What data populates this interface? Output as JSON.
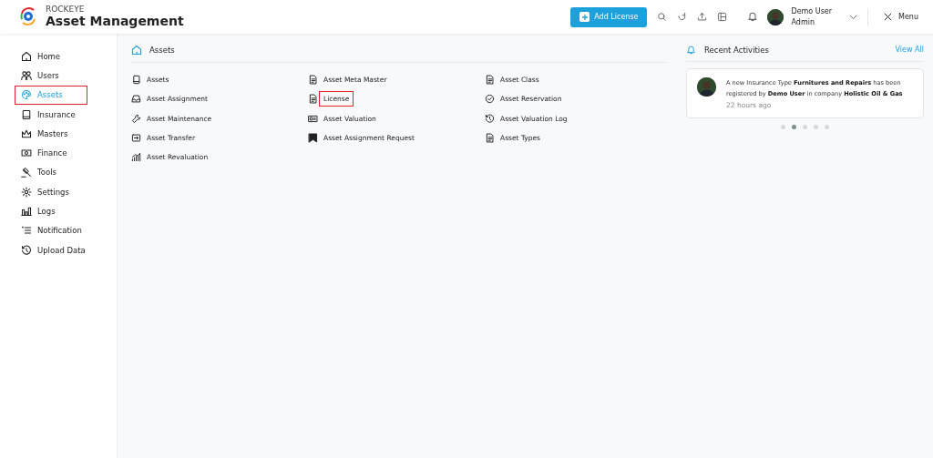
{
  "header": {
    "brand": "ROCKEYE",
    "title": "Asset Management",
    "add_button": "Add License",
    "user": {
      "name": "Demo User",
      "role": "Admin"
    },
    "menu": "Menu"
  },
  "sidebar": {
    "items": [
      {
        "label": "Home",
        "selected": false,
        "highlighted": false
      },
      {
        "label": "Users",
        "selected": false,
        "highlighted": false
      },
      {
        "label": "Assets",
        "selected": true,
        "highlighted": true
      },
      {
        "label": "Insurance",
        "selected": false,
        "highlighted": false
      },
      {
        "label": "Masters",
        "selected": false,
        "highlighted": false
      },
      {
        "label": "Finance",
        "selected": false,
        "highlighted": false
      },
      {
        "label": "Tools",
        "selected": false,
        "highlighted": false
      },
      {
        "label": "Settings",
        "selected": false,
        "highlighted": false
      },
      {
        "label": "Logs",
        "selected": false,
        "highlighted": false
      },
      {
        "label": "Notification",
        "selected": false,
        "highlighted": false
      },
      {
        "label": "Upload Data",
        "selected": false,
        "highlighted": false
      }
    ]
  },
  "assets_panel": {
    "title": "Assets",
    "items": [
      {
        "label": "Assets",
        "highlighted": false
      },
      {
        "label": "Asset Meta Master",
        "highlighted": false
      },
      {
        "label": "Asset Class",
        "highlighted": false
      },
      {
        "label": "Asset Assignment",
        "highlighted": false
      },
      {
        "label": "License",
        "highlighted": true
      },
      {
        "label": "Asset Reservation",
        "highlighted": false
      },
      {
        "label": "Asset Maintenance",
        "highlighted": false
      },
      {
        "label": "Asset Valuation",
        "highlighted": false
      },
      {
        "label": "Asset Valuation Log",
        "highlighted": false
      },
      {
        "label": "Asset Transfer",
        "highlighted": false
      },
      {
        "label": "Asset Assignment Request",
        "highlighted": false
      },
      {
        "label": "Asset Types",
        "highlighted": false
      },
      {
        "label": "Asset Revaluation",
        "highlighted": false
      }
    ]
  },
  "recent_activities": {
    "title": "Recent Activities",
    "view_all": "View All",
    "activity": {
      "text": "A new Insurance Type **Furnitures and Repairs** has been registered by **Demo User** in company **Holistic Oil & Gas**",
      "time": "22 hours ago"
    },
    "dots": [
      {
        "selected": false
      },
      {
        "selected": true
      },
      {
        "selected": false
      },
      {
        "selected": false
      },
      {
        "selected": false
      }
    ]
  }
}
